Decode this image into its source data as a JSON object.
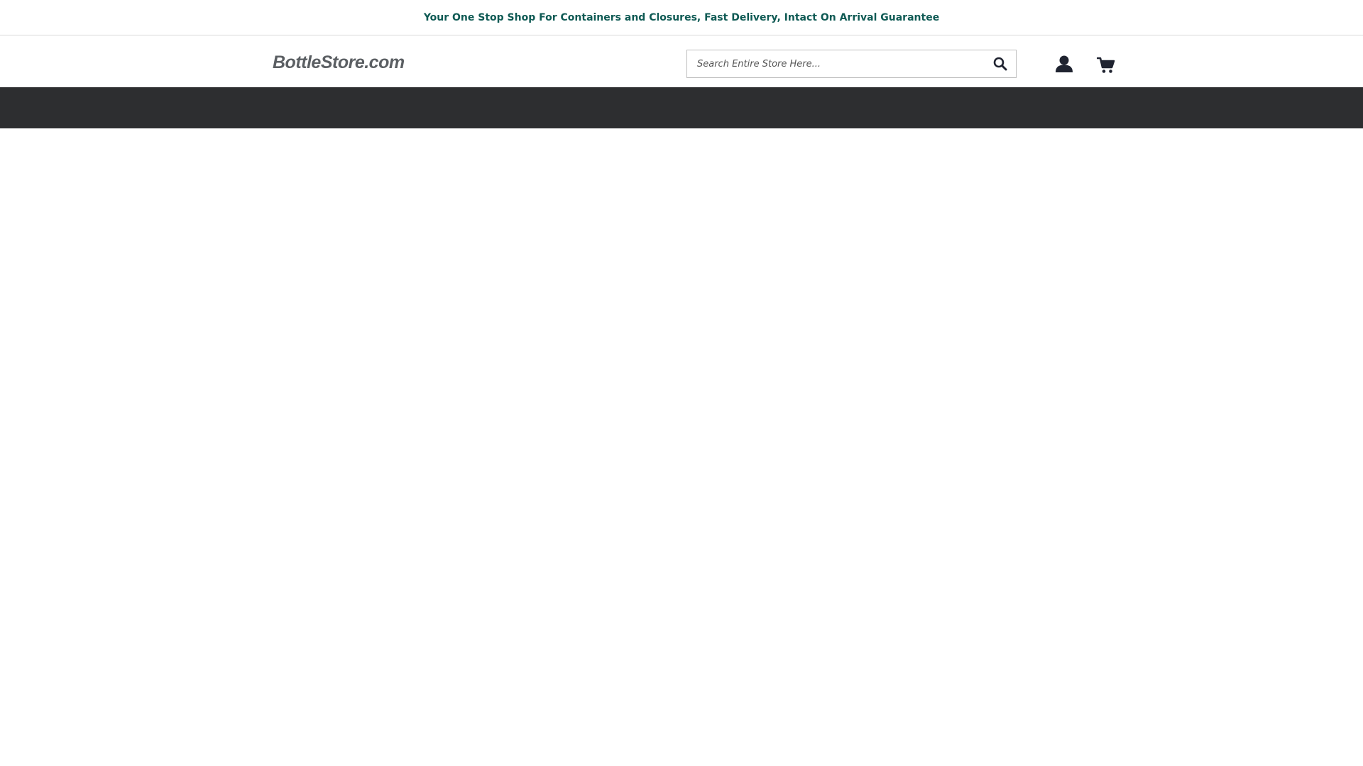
{
  "promo": {
    "text": "Your One Stop Shop For Containers and Closures, Fast Delivery, Intact On Arrival Guarantee"
  },
  "header": {
    "logo_text": "BottleStore.com",
    "search": {
      "placeholder": "Search Entire Store Here...",
      "value": ""
    },
    "icons": {
      "search": "search-icon",
      "account": "user-icon",
      "cart": "cart-icon"
    }
  },
  "colors": {
    "brand_teal": "#0f5a54",
    "logo_light_teal": "#6aa9a3",
    "logo_text_gray": "#5b5f63",
    "nav_bar": "#2d2e30",
    "icon_dark": "#1f2330"
  }
}
